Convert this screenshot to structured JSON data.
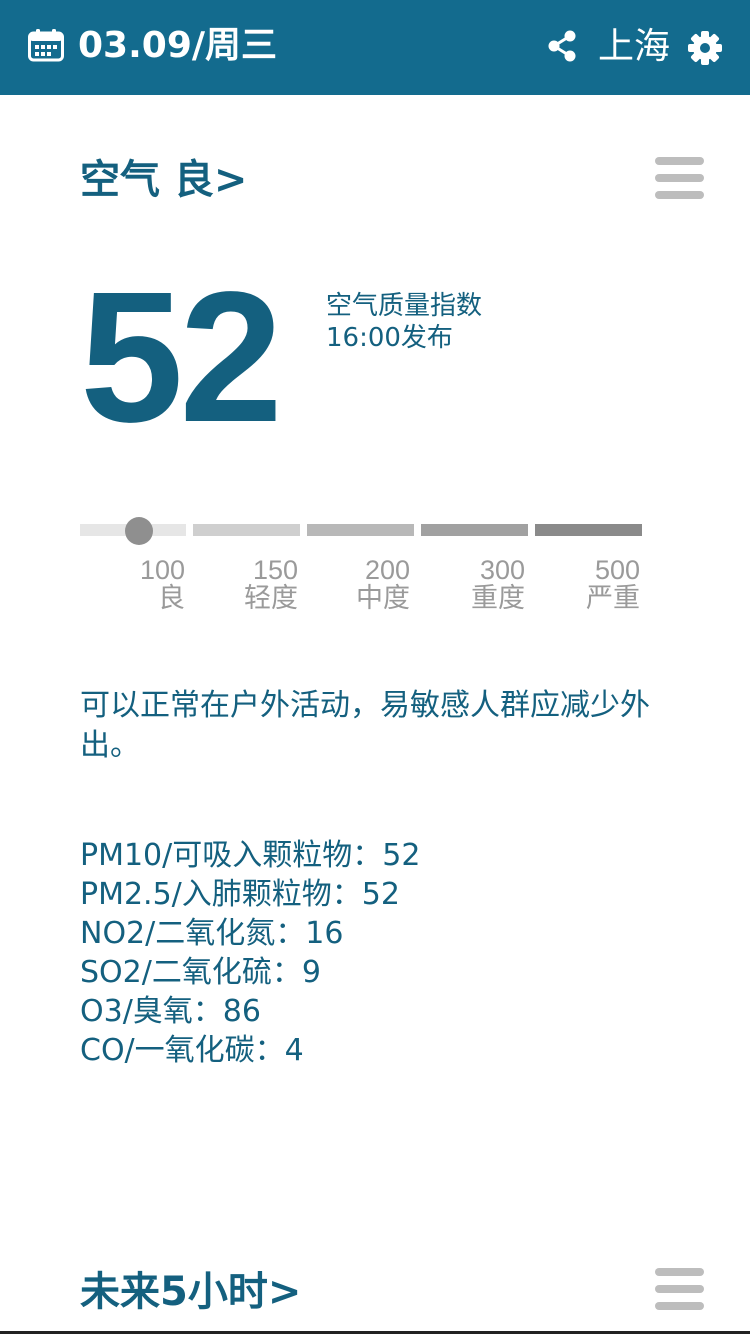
{
  "header": {
    "date": "03.09/周三",
    "city": "上海",
    "calendar_icon": "calendar-icon",
    "share_icon": "share-icon",
    "settings_icon": "gear-icon",
    "bg_color": "#136b8e"
  },
  "air": {
    "title": "空气 良>",
    "aqi": "52",
    "aqi_label": "空气质量指数",
    "publish_time": "16:00发布",
    "scale": [
      {
        "value": "100",
        "level": "良"
      },
      {
        "value": "150",
        "level": "轻度"
      },
      {
        "value": "200",
        "level": "中度"
      },
      {
        "value": "300",
        "level": "重度"
      },
      {
        "value": "500",
        "level": "严重"
      }
    ],
    "advice": "可以正常在户外活动，易敏感人群应减少外出。"
  },
  "pollutants": [
    {
      "label": "PM10/可吸入颗粒物：52"
    },
    {
      "label": "PM2.5/入肺颗粒物：52"
    },
    {
      "label": "NO2/二氧化氮：16"
    },
    {
      "label": "SO2/二氧化硫：9"
    },
    {
      "label": "O3/臭氧：86"
    },
    {
      "label": "CO/一氧化碳：4"
    }
  ],
  "forecast": {
    "title": "未来5小时>"
  },
  "colors": {
    "accent": "#14607f",
    "scale_light": "#e6e6e6",
    "scale_dark": "#8a8a8a"
  }
}
